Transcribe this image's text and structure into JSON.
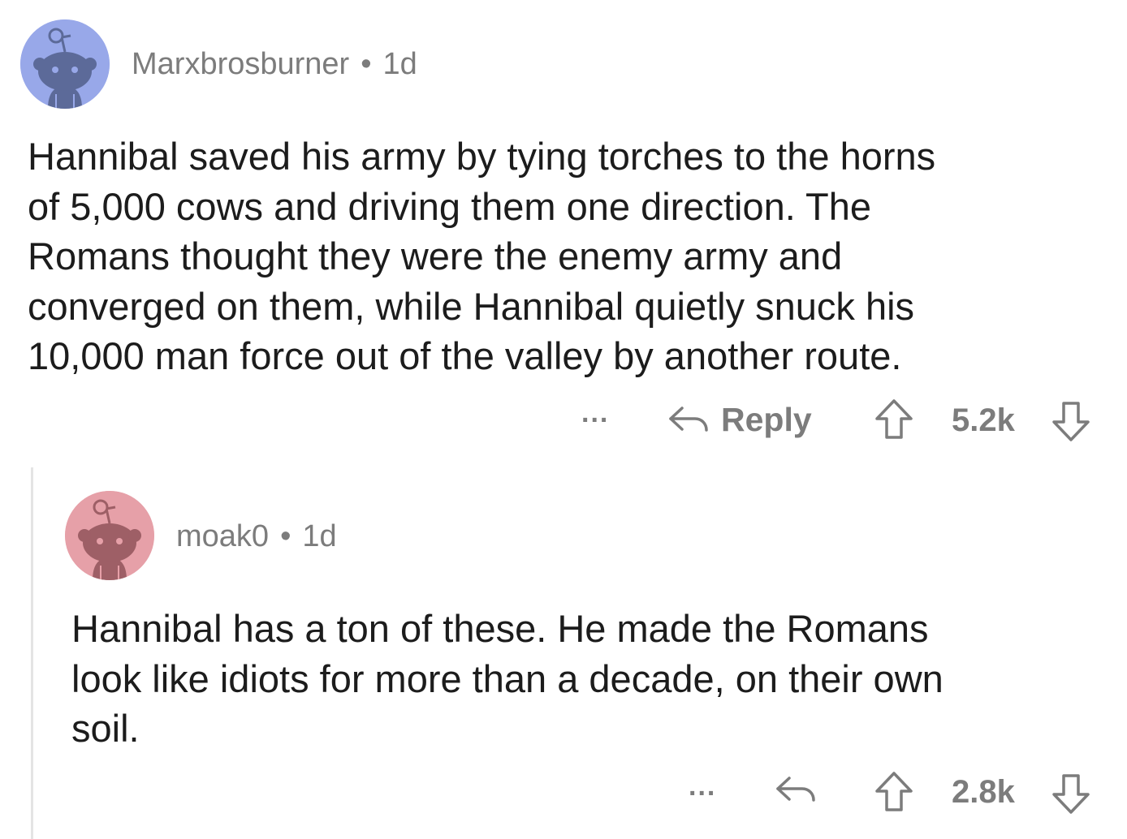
{
  "comments": [
    {
      "author": "Marxbrosburner",
      "age": "1d",
      "avatar_color": "#98a8e9",
      "avatar_icon": "snoo-avatar-icon",
      "body_lines": [
        "Hannibal saved his army by tying torches to the horns",
        "of 5,000 cows and driving them one direction. The",
        "Romans thought they were the enemy army and",
        "converged on them, while Hannibal quietly snuck his",
        "10,000 man force out of the valley by another route."
      ],
      "more_label": "...",
      "reply_label": "Reply",
      "score": "5.2k"
    },
    {
      "author": "moak0",
      "age": "1d",
      "avatar_color": "#e6a0a8",
      "avatar_icon": "snoo-avatar-icon",
      "body_lines": [
        "Hannibal has a ton of these.  He made the Romans",
        "look like idiots for more than a decade, on their own",
        "soil."
      ],
      "more_label": "...",
      "score": "2.8k"
    }
  ],
  "separator": "•",
  "colors": {
    "meta_text": "#7c7c7c",
    "body_text": "#1c1c1c",
    "thread_line": "#e4e4e4"
  }
}
